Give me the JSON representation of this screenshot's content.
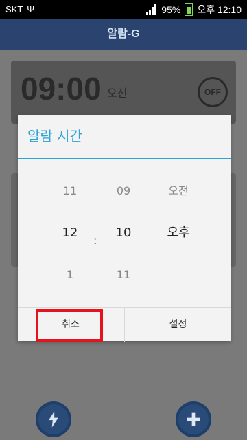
{
  "status_bar": {
    "carrier": "SKT",
    "usb_icon": "usb-icon",
    "battery_percent": "95%",
    "time": "오후 12:10"
  },
  "app": {
    "title": "알람-G"
  },
  "background": {
    "alarm_card": {
      "time": "09:00",
      "ampm": "오전",
      "status": "OFF"
    }
  },
  "dialog": {
    "title": "알람 시간",
    "picker": {
      "hour": {
        "prev": "11",
        "current": "12",
        "next": "1"
      },
      "minute": {
        "prev": "09",
        "current": "10",
        "next": "11"
      },
      "ampm": {
        "prev": "오전",
        "current": "오후"
      },
      "separator": ":"
    },
    "buttons": {
      "cancel": "취소",
      "set": "설정"
    }
  },
  "bottom_bar": {
    "left_icon": "alarm-lightning-icon",
    "right_icon": "alarm-add-icon"
  },
  "colors": {
    "accent": "#2aa3d8",
    "appbar": "#2a446f",
    "highlight": "#e6121e"
  }
}
